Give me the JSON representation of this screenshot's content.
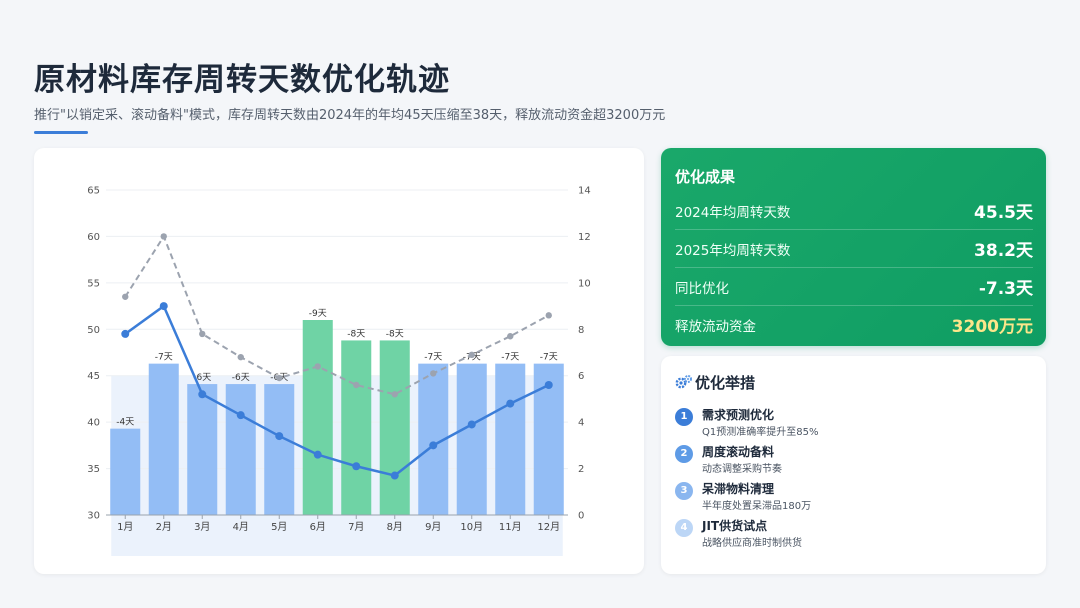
{
  "header": {
    "title": "原材料库存周转天数优化轨迹",
    "subtitle": "推行\"以销定采、滚动备料\"模式，库存周转天数由2024年的年均45天压缩至38天，释放流动资金超3200万元"
  },
  "colors": {
    "bar_blue": "#93bdf5",
    "bar_green": "#6fd3a5",
    "line_2025": "#3b7dd8",
    "line_2024": "#9ca3af",
    "accent": "#3b7dd8",
    "result_bg": "#14a368"
  },
  "chart_data": {
    "type": "bar",
    "categories": [
      "1月",
      "2月",
      "3月",
      "4月",
      "5月",
      "6月",
      "7月",
      "8月",
      "9月",
      "10月",
      "11月",
      "12月"
    ],
    "bar_labels": [
      "-4天",
      "-7天",
      "-6天",
      "-6天",
      "-6天",
      "-9天",
      "-8天",
      "-8天",
      "-7天",
      "-7天",
      "-7天",
      "-7天"
    ],
    "bar_highlight": [
      false,
      false,
      false,
      false,
      false,
      true,
      true,
      true,
      false,
      false,
      false,
      false
    ],
    "series": [
      {
        "type": "bar",
        "axis": "left",
        "values": [
          39.3,
          46.3,
          44.1,
          44.1,
          44.1,
          51.0,
          48.8,
          48.8,
          46.3,
          46.3,
          46.3,
          46.3
        ]
      },
      {
        "type": "line",
        "style": "solid",
        "axis": "right",
        "values": [
          7.8,
          9.0,
          5.2,
          4.3,
          3.4,
          2.6,
          2.1,
          1.7,
          3.0,
          3.9,
          4.8,
          5.6
        ]
      },
      {
        "type": "line",
        "style": "dashed",
        "axis": "right",
        "values": [
          9.4,
          12.0,
          7.8,
          6.8,
          5.9,
          6.4,
          5.6,
          5.2,
          6.1,
          6.9,
          7.7,
          8.6
        ]
      }
    ],
    "y_left": {
      "min": 30,
      "max": 65,
      "ticks": [
        30,
        35,
        40,
        45,
        50,
        55,
        60,
        65
      ]
    },
    "y_right": {
      "min": 0,
      "max": 14,
      "ticks": [
        0,
        2,
        4,
        6,
        8,
        10,
        12,
        14
      ]
    },
    "grid": true
  },
  "results": {
    "title": "优化成果",
    "rows": [
      {
        "label": "2024年均周转天数",
        "value": "45.5天"
      },
      {
        "label": "2025年均周转天数",
        "value": "38.2天"
      },
      {
        "label": "同比优化",
        "value": "-7.3天"
      },
      {
        "label": "释放流动资金",
        "value": "3200万元"
      }
    ]
  },
  "actions": {
    "title": "优化举措",
    "icon": "gear-icon",
    "items": [
      {
        "num": "1",
        "name": "需求预测优化",
        "desc": "Q1预测准确率提升至85%",
        "color": "#3b7dd8"
      },
      {
        "num": "2",
        "name": "周度滚动备料",
        "desc": "动态调整采购节奏",
        "color": "#5e9be6"
      },
      {
        "num": "3",
        "name": "呆滞物料清理",
        "desc": "半年度处置呆滞品180万",
        "color": "#8ab6ef"
      },
      {
        "num": "4",
        "name": "JIT供货试点",
        "desc": "战略供应商准时制供货",
        "color": "#bcd6f6"
      }
    ]
  }
}
